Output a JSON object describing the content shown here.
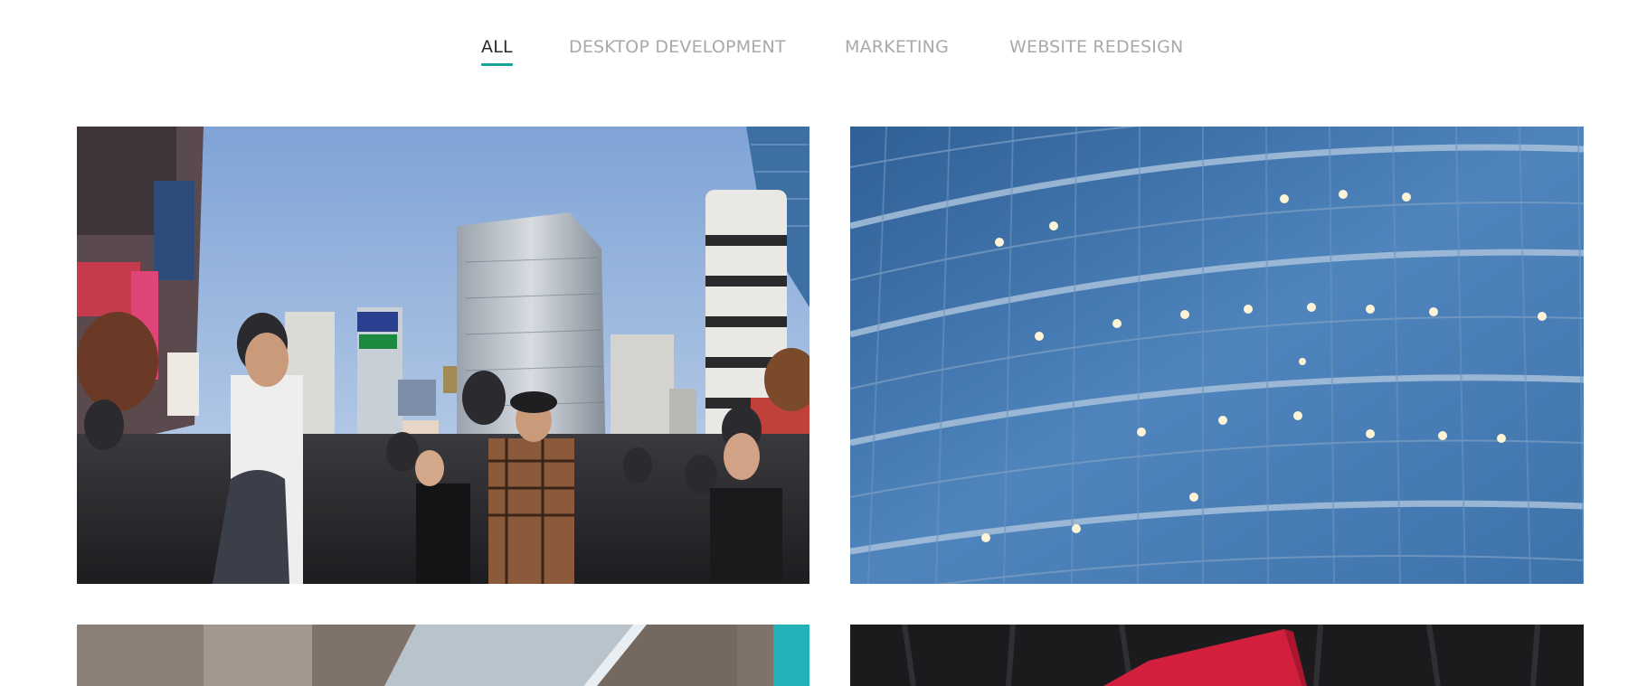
{
  "filters": {
    "tabs": [
      {
        "label": "ALL",
        "active": true
      },
      {
        "label": "DESKTOP DEVELOPMENT",
        "active": false
      },
      {
        "label": "MARKETING",
        "active": false
      },
      {
        "label": "WEBSITE REDESIGN",
        "active": false
      }
    ],
    "accent_color": "#16a59a",
    "active_color": "#2b2b2b",
    "inactive_color": "#a9a9a9"
  },
  "portfolio": {
    "items": [
      {
        "image": "city-crosswalk-crowd-photo"
      },
      {
        "image": "glass-office-building-facade-photo"
      },
      {
        "image": "laptop-on-wooden-desk-photo"
      },
      {
        "image": "red-notebook-on-leather-photo"
      }
    ]
  }
}
